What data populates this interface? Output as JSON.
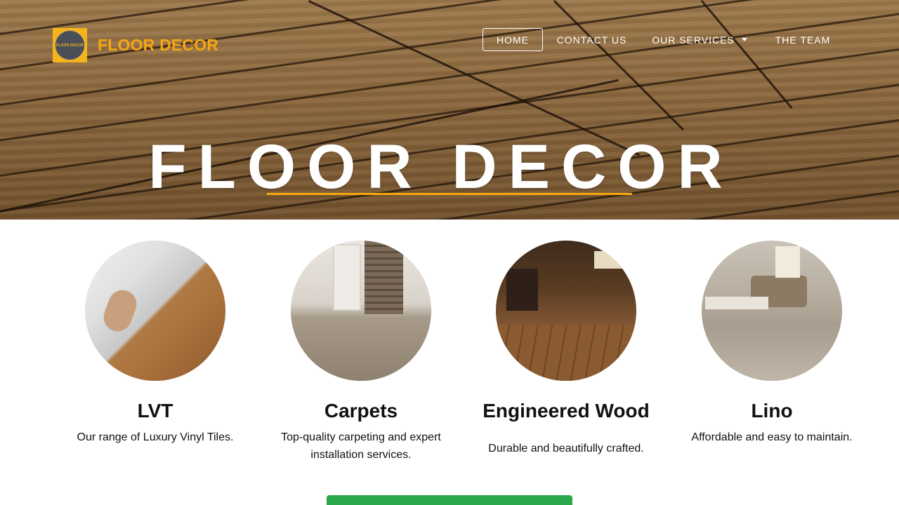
{
  "brand": {
    "name": "FLOOR DECOR",
    "badge_text": "FLOOR DECOR",
    "accent_color": "#f5a712"
  },
  "nav": {
    "items": [
      {
        "label": "HOME",
        "active": true
      },
      {
        "label": "CONTACT US",
        "active": false
      },
      {
        "label": "OUR SERVICES",
        "active": false,
        "has_dropdown": true
      },
      {
        "label": "THE TEAM",
        "active": false
      }
    ]
  },
  "hero": {
    "title": "FLOOR DECOR"
  },
  "services": [
    {
      "name": "LVT",
      "description": "Our range of Luxury Vinyl Tiles.",
      "image": "vinyl-plank-install-photo"
    },
    {
      "name": "Carpets",
      "description": "Top-quality carpeting and expert installation services.",
      "image": "carpeted-hallway-photo"
    },
    {
      "name": "Engineered Wood",
      "description": "Durable and beautifully crafted.",
      "image": "wood-floor-living-room-photo"
    },
    {
      "name": "Lino",
      "description": "Affordable and easy to maintain.",
      "image": "lino-living-room-photo"
    }
  ],
  "cta": {
    "color": "#2aa84a"
  }
}
